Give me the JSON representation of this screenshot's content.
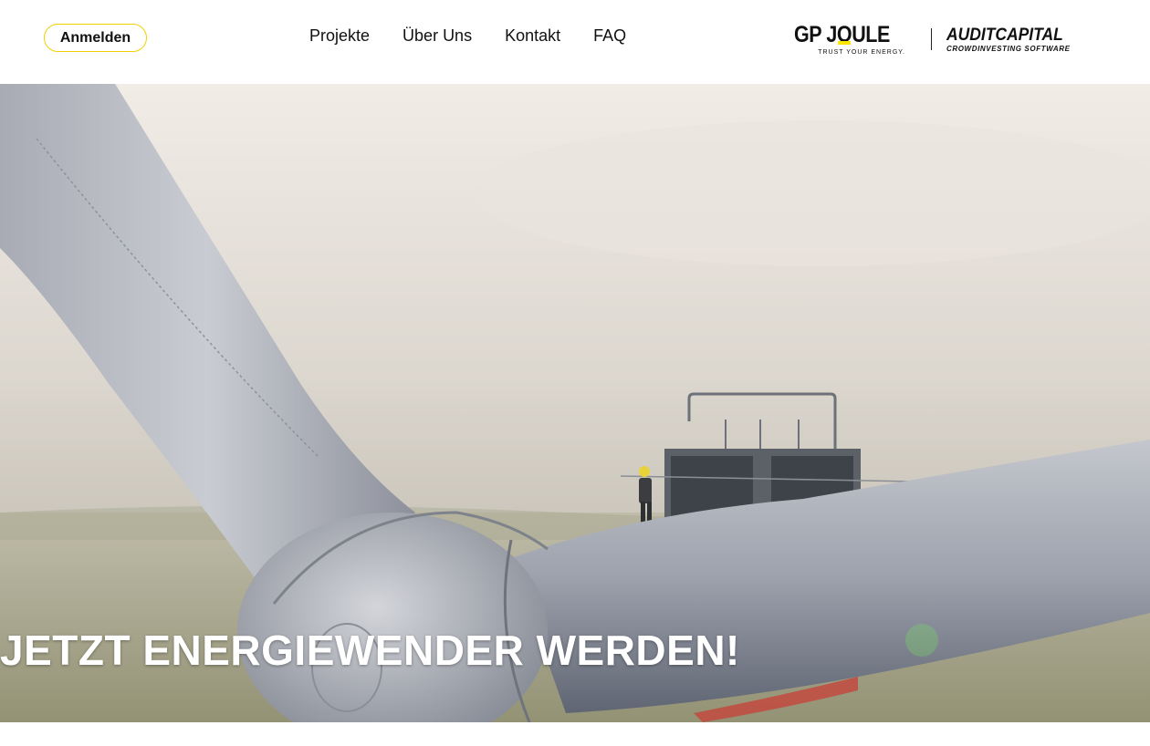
{
  "header": {
    "login_label": "Anmelden",
    "nav": [
      {
        "label": "Projekte"
      },
      {
        "label": "Über Uns"
      },
      {
        "label": "Kontakt"
      },
      {
        "label": "FAQ"
      }
    ],
    "logo_gpjoule": {
      "text_prefix": "GP J",
      "text_o": "O",
      "text_suffix": "ULE",
      "tagline": "TRUST YOUR ENERGY."
    },
    "logo_auditcapital": {
      "text": "AUDITCAPITAL",
      "subtitle": "CROWDINVESTING SOFTWARE"
    }
  },
  "hero": {
    "title": "JETZT ENERGIEWENDER WERDEN!",
    "image_icon": "wind-turbine-photo"
  },
  "colors": {
    "accent": "#f2d000",
    "text": "#111111",
    "hero_text": "#ffffff"
  }
}
